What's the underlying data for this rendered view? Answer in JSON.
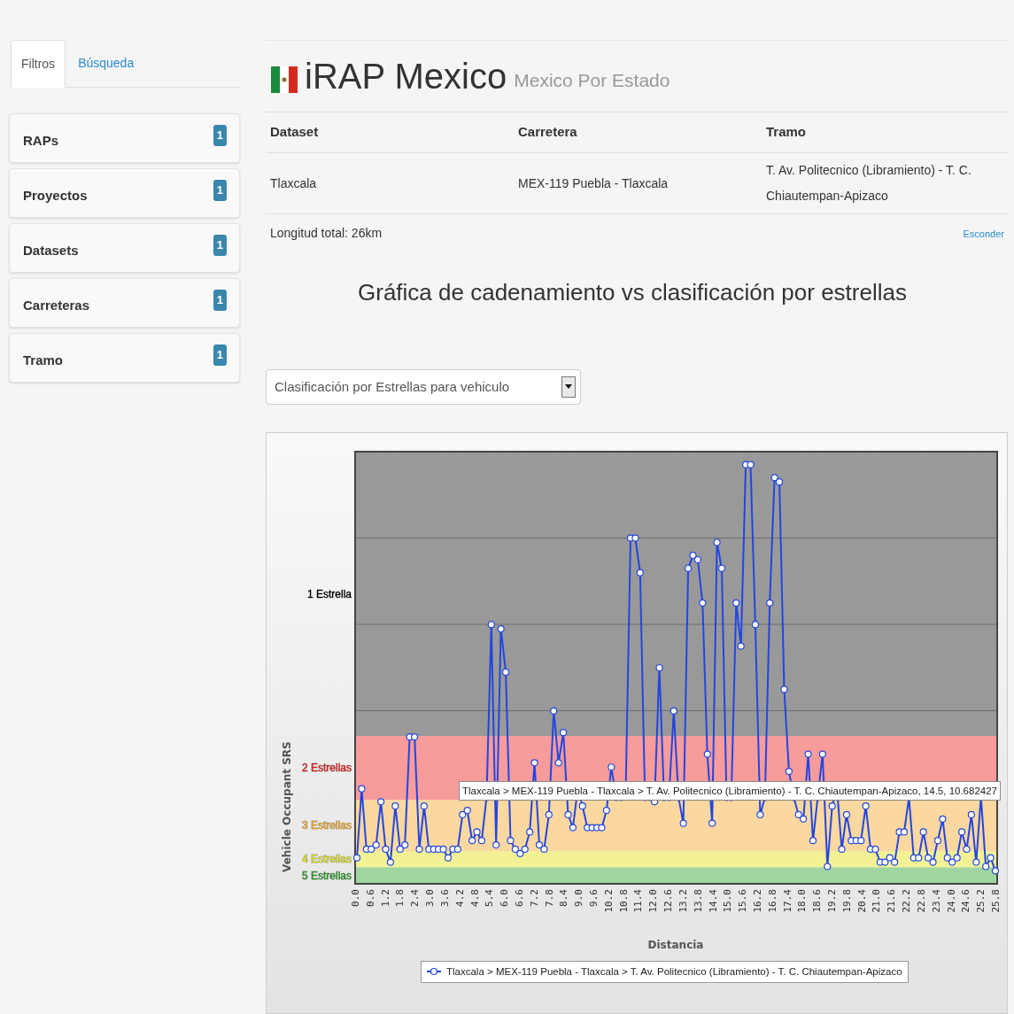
{
  "sidebar": {
    "tabs": [
      {
        "label": "Filtros",
        "selected": true
      },
      {
        "label": "Búsqueda",
        "selected": false
      }
    ],
    "filters": [
      {
        "label": "RAPs",
        "count": "1"
      },
      {
        "label": "Proyectos",
        "count": "1"
      },
      {
        "label": "Datasets",
        "count": "1"
      },
      {
        "label": "Carreteras",
        "count": "1"
      },
      {
        "label": "Tramo",
        "count": "1"
      }
    ]
  },
  "header": {
    "title": "iRAP Mexico",
    "subtitle": "Mexico Por Estado"
  },
  "info_table": {
    "columns": [
      "Dataset",
      "Carretera",
      "Tramo"
    ],
    "rows": [
      [
        "Tlaxcala",
        "MEX-119 Puebla - Tlaxcala",
        "T. Av. Politecnico (Libramiento) - T. C. Chiautempan-Apizaco"
      ]
    ]
  },
  "total_length": "Longitud total: 26km",
  "hide_link": "Esconder",
  "chart_title": "Gráfica de cadenamiento vs clasificación por estrellas",
  "rating_select": {
    "value": "Clasificación por Estrellas para vehiculo"
  },
  "chart": {
    "y_axis_title": "Vehicle Occupant SRS",
    "x_axis_title": "Distancia",
    "bands": [
      {
        "label": "1 Estrella",
        "color": "#000000"
      },
      {
        "label": "2 Estrellas",
        "color": "#ee1111"
      },
      {
        "label": "3 Estrellas",
        "color": "#f5a21a"
      },
      {
        "label": "4 Estrellas",
        "color": "#e0e000"
      },
      {
        "label": "5 Estrellas",
        "color": "#1c9a1c"
      }
    ],
    "x_tick_labels": [
      "0.0",
      "0.6",
      "1.2",
      "1.8",
      "2.4",
      "3.0",
      "3.6",
      "4.2",
      "4.8",
      "5.4",
      "6.0",
      "6.6",
      "7.2",
      "7.8",
      "8.4",
      "9.0",
      "9.6",
      "10.2",
      "10.8",
      "11.4",
      "12.0",
      "12.6",
      "13.2",
      "13.8",
      "14.4",
      "15.0",
      "15.6",
      "16.2",
      "16.8",
      "17.4",
      "18.0",
      "18.6",
      "19.2",
      "19.8",
      "20.4",
      "21.0",
      "21.6",
      "22.2",
      "22.8",
      "23.4",
      "24.0",
      "24.6",
      "25.2",
      "25.8"
    ],
    "tooltip": "Tlaxcala > MEX-119 Puebla - Tlaxcala > T. Av. Politecnico (Libramiento) - T. C. Chiautempan-Apizaco, 14.5, 10.682427",
    "legend": "Tlaxcala > MEX-119 Puebla - Tlaxcala > T. Av. Politecnico (Libramiento) - T. C. Chiautempan-Apizaco"
  }
}
